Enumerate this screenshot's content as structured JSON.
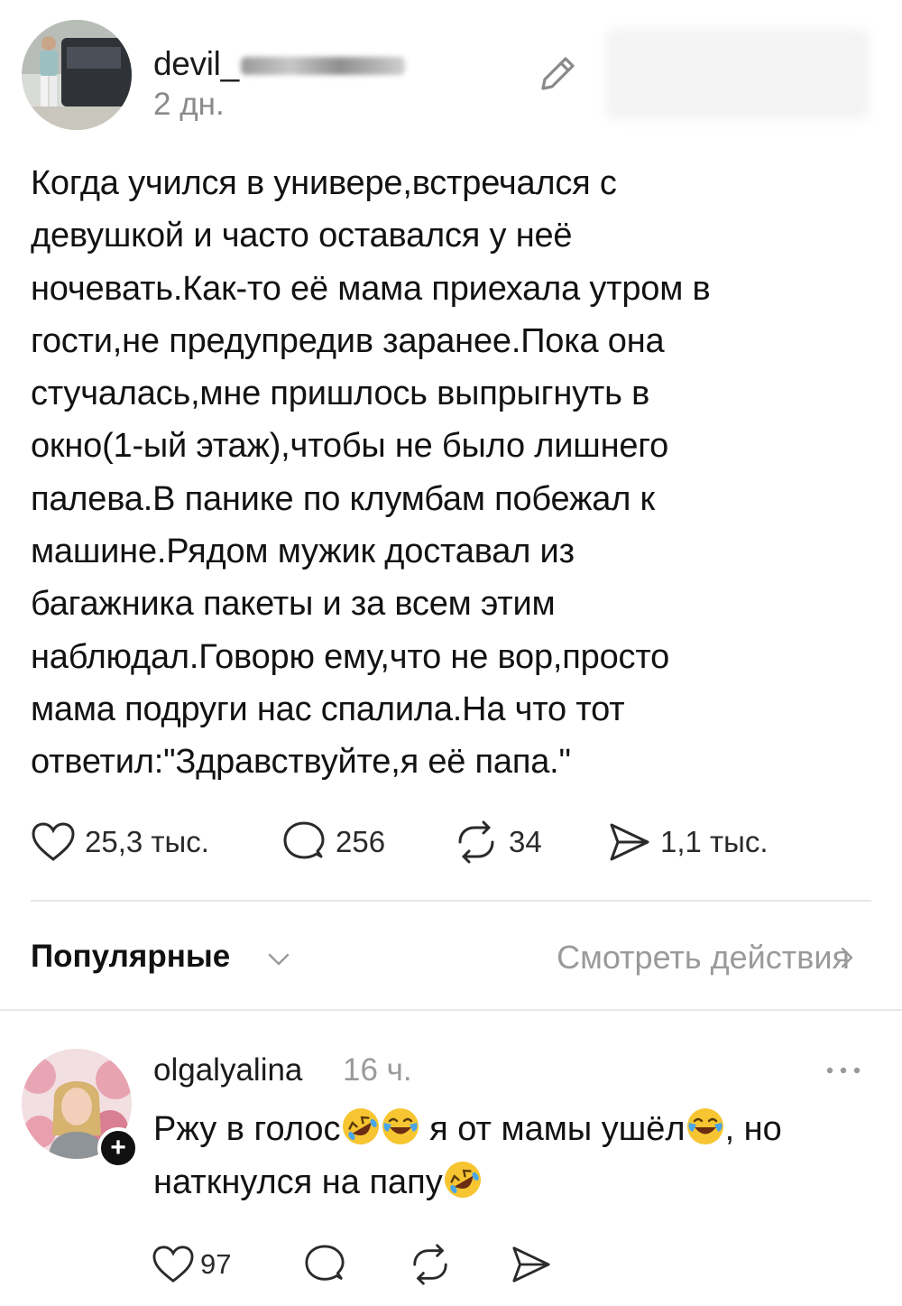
{
  "post": {
    "username": "devil_",
    "time": "2 дн.",
    "text": "Когда учился в универе,встречался с\nдевушкой и часто оставался у неё\nночевать.Как-то её мама приехала утром в\nгости,не предупредив заранее.Пока она\nстучалась,мне пришлось выпрыгнуть  в\nокно(1-ый этаж),чтобы не было лишнего\nпалева.В панике по клумбам побежал к\nмашине.Рядом мужик доставал из\nбагажника пакеты и за всем этим\nнаблюдал.Говорю ему,что не вор,просто\nмама подруги нас спалила.На что тот\nответил:\"Здравствуйте,я её папа.\"",
    "likes": "25,3 тыс.",
    "comments": "256",
    "reposts": "34",
    "shares": "1,1 тыс."
  },
  "controls": {
    "sort_label": "Популярные",
    "view_actions": "Смотреть действия"
  },
  "comment": {
    "username": "olgalyalina",
    "time": "16 ч.",
    "text_1": "Ржу в голос",
    "text_2": " я от мамы ушёл",
    "text_3": ", но наткнулся на папу",
    "likes": "97"
  },
  "colors": {
    "text": "#111111",
    "muted": "#8a8a8a",
    "divider": "#e6e6e6",
    "emoji": "#f6c531"
  },
  "icons": [
    "pencil-icon",
    "heart-icon",
    "comment-icon",
    "repost-icon",
    "send-icon",
    "chevron-down-icon",
    "chevron-right-icon",
    "more-icon",
    "plus-icon",
    "rofl-emoji",
    "joy-emoji"
  ]
}
